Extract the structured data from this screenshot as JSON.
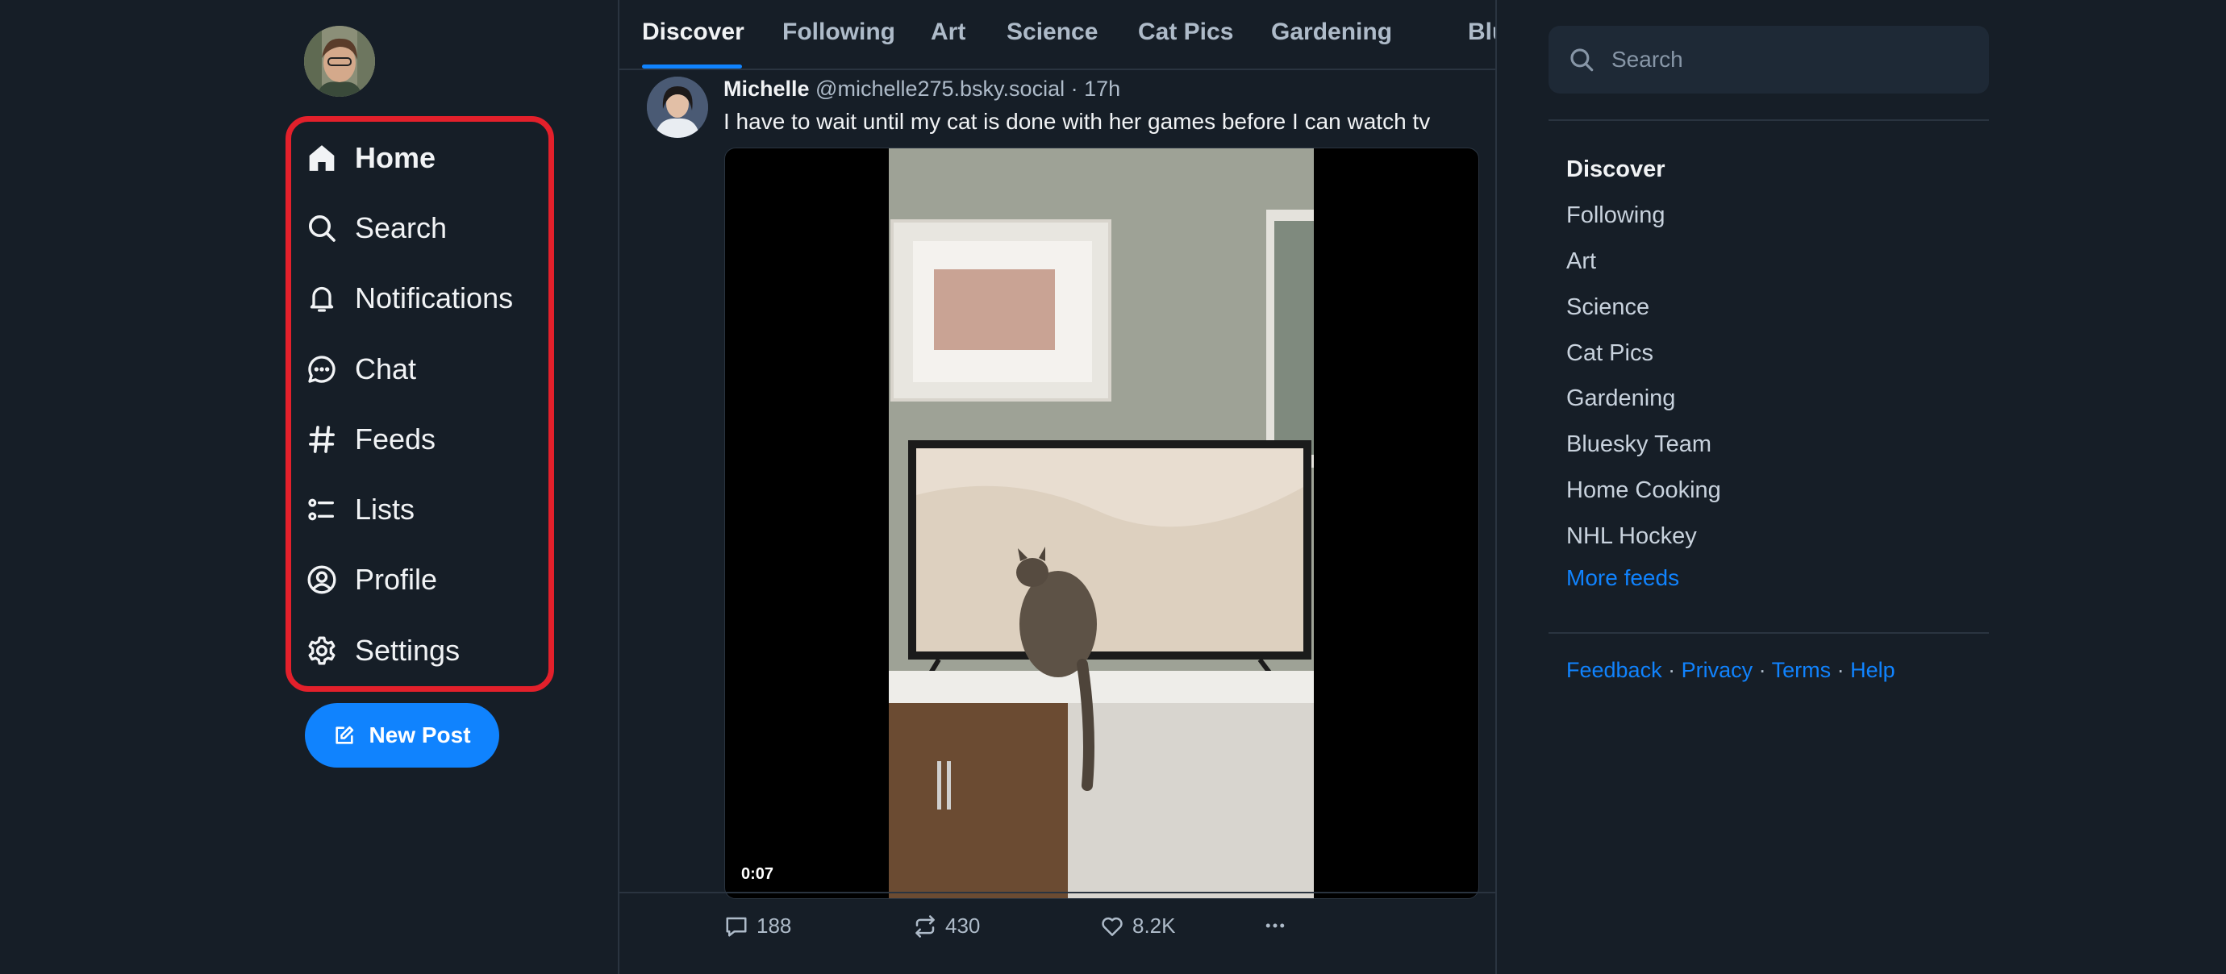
{
  "sidebar": {
    "items": [
      {
        "label": "Home",
        "icon": "home-icon",
        "active": true
      },
      {
        "label": "Search",
        "icon": "search-icon",
        "active": false
      },
      {
        "label": "Notifications",
        "icon": "bell-icon",
        "active": false
      },
      {
        "label": "Chat",
        "icon": "chat-icon",
        "active": false
      },
      {
        "label": "Feeds",
        "icon": "hash-icon",
        "active": false
      },
      {
        "label": "Lists",
        "icon": "list-icon",
        "active": false
      },
      {
        "label": "Profile",
        "icon": "user-circle-icon",
        "active": false
      },
      {
        "label": "Settings",
        "icon": "gear-icon",
        "active": false
      }
    ],
    "new_post_label": "New Post",
    "highlight_color": "#e3202b"
  },
  "tabs": [
    {
      "label": "Discover",
      "active": true
    },
    {
      "label": "Following",
      "active": false
    },
    {
      "label": "Art",
      "active": false
    },
    {
      "label": "Science",
      "active": false
    },
    {
      "label": "Cat Pics",
      "active": false
    },
    {
      "label": "Gardening",
      "active": false
    },
    {
      "label": "Bluesk",
      "active": false
    }
  ],
  "post": {
    "author": "Michelle",
    "meta": " @michelle275.bsky.social · 17h",
    "text": "I have to wait until my cat is done with her games before I can watch tv",
    "video_time": "0:07",
    "replies": "188",
    "reposts": "430",
    "likes": "8.2K"
  },
  "right": {
    "search_placeholder": "Search",
    "feeds": [
      {
        "label": "Discover",
        "active": true
      },
      {
        "label": "Following",
        "active": false
      },
      {
        "label": "Art",
        "active": false
      },
      {
        "label": "Science",
        "active": false
      },
      {
        "label": "Cat Pics",
        "active": false
      },
      {
        "label": "Gardening",
        "active": false
      },
      {
        "label": "Bluesky Team",
        "active": false
      },
      {
        "label": "Home Cooking",
        "active": false
      },
      {
        "label": "NHL Hockey",
        "active": false
      }
    ],
    "more_feeds": "More feeds",
    "footer": {
      "feedback": "Feedback",
      "privacy": "Privacy",
      "terms": "Terms",
      "help": "Help",
      "separator": " · "
    }
  },
  "colors": {
    "accent": "#1083fe",
    "background": "#161e27",
    "muted_text": "#aebbc9"
  }
}
